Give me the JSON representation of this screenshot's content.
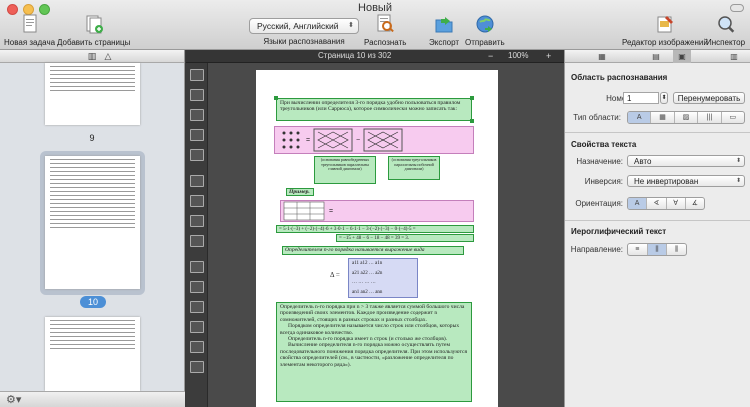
{
  "window": {
    "title": "Новый"
  },
  "toolbar": {
    "new_task": "Новая задача",
    "add_pages": "Добавить страницы",
    "languages_value": "Русский, Английский",
    "languages_label": "Языки распознавания",
    "recognize": "Распознать",
    "export": "Экспорт",
    "send": "Отправить",
    "image_editor": "Редактор изображений",
    "inspector": "Инспектор"
  },
  "thumbnails": {
    "labels": [
      "9",
      "10"
    ]
  },
  "viewer": {
    "page_info": "Страница 10 из 302",
    "zoom": "100%"
  },
  "doc": {
    "p1": "При вычислении определителя 3-го порядка удобно пользоваться правилом треугольников (или Саррюса), которое символически можно записать так:",
    "cap1": "(основания равнобедренных треугольников параллельны главной диагонали)",
    "cap2": "(основания треугольников параллельны побочной диагонали)",
    "example": "Пример.",
    "calc": "= 5·1·(−3) + (−2)·(−4)·6 + 3·0·1 − 6·1·1 − 3·(−2)·(−3) − 0·(−4)·5 =",
    "result": "= −15 + 48 − 6 − 18 − 48 = 39 = 3.",
    "def": "Определителем n-го порядка называется выражение вида",
    "delta": "Δ =",
    "m1": "a11 a12 … a1n",
    "m2": "a21 a22 … a2n",
    "m3": "… … … …",
    "m4": "an1 an2 … ann",
    "body1": "Определитель n-го порядка при n > 3 также является суммой большого числа произведений своих элементов. Каждое произведение содержит n сомножителей, стоящих в разных строках и разных столбцах.",
    "body2": "Порядком определителя называется число строк или столбцов, которых всегда одинаковое количество.",
    "body3": "Определитель n-го порядка имеет n строк (и столько же столбцов).",
    "body4": "Вычисление определителя n-го порядка можно осуществлять путем последовательного понижения порядка определителя. При этом используются свойства определителей (см., в частности, «разложение определителя по элементам некоторого ряда»)."
  },
  "inspector": {
    "area_title": "Область распознавания",
    "number_label": "Номер:",
    "number_value": "1",
    "renumber": "Перенумеровать",
    "area_type_label": "Тип области:",
    "text_props_title": "Свойства текста",
    "purpose_label": "Назначение:",
    "purpose_value": "Авто",
    "inversion_label": "Инверсия:",
    "inversion_value": "Не инвертирован",
    "orientation_label": "Ориентация:",
    "cjk_title": "Иероглифический текст",
    "direction_label": "Направление:"
  },
  "colors": {
    "area_green": "#2c9a3e",
    "table_pink": "#f5bee9",
    "accent_blue": "#4c8fd6"
  }
}
